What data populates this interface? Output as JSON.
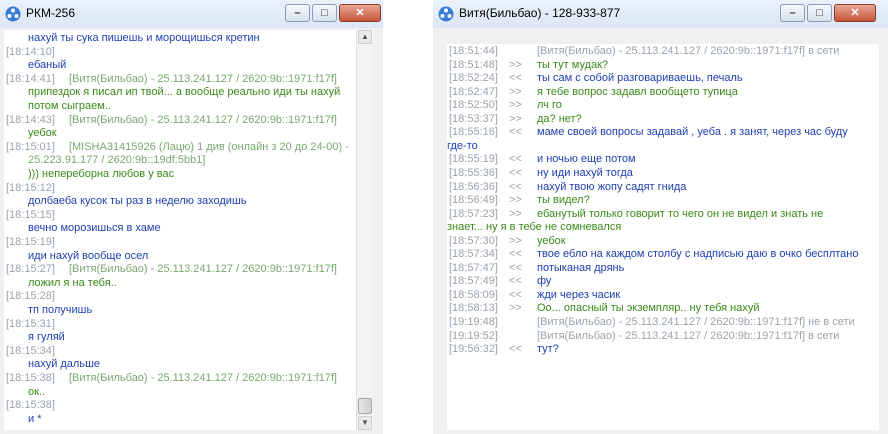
{
  "left_window": {
    "title": "РКМ-256",
    "buttons": {
      "minimize": "–",
      "maximize": "□",
      "close": "✕"
    },
    "messages": [
      {
        "ts": "",
        "text": "нахуй ты сука пишешь и морощишься кретин",
        "style": "me"
      },
      {
        "ts": "[18:14:10]",
        "text": "",
        "style": "ts"
      },
      {
        "ts": "",
        "text": "ебаный",
        "style": "me"
      },
      {
        "ts": "[18:14:41]",
        "text": "[Витя(Бильбао) - 25.113.241.127 / 2620:9b::1971:f17f]",
        "style": "info"
      },
      {
        "ts": "",
        "text": "припездок я писал ип твой... а вообще реально иди ты нахуй",
        "style": "peer"
      },
      {
        "ts": "",
        "text": "потом сыграем..",
        "style": "peer"
      },
      {
        "ts": "[18:14:43]",
        "text": "[Витя(Бильбао) - 25.113.241.127 / 2620:9b::1971:f17f]",
        "style": "info"
      },
      {
        "ts": "",
        "text": "уебок",
        "style": "peer"
      },
      {
        "ts": "[18:15:01]",
        "text": "[MISHA31415926 (Лацю) 1 див (онлайн з 20 до 24-00) -",
        "style": "info"
      },
      {
        "ts": "",
        "text": "25.223.91.177 / 2620:9b::19df:5bb1]",
        "style": "info"
      },
      {
        "ts": "",
        "text": "))) непереборна любов у вас",
        "style": "peer"
      },
      {
        "ts": "[18:15:12]",
        "text": "",
        "style": "ts"
      },
      {
        "ts": "",
        "text": "долбаеба кусок ты раз в неделю заходишь",
        "style": "me"
      },
      {
        "ts": "[18:15:15]",
        "text": "",
        "style": "ts"
      },
      {
        "ts": "",
        "text": "вечно морозишься в хаме",
        "style": "me"
      },
      {
        "ts": "[18:15:19]",
        "text": "",
        "style": "ts"
      },
      {
        "ts": "",
        "text": "иди нахуй вообще осел",
        "style": "me"
      },
      {
        "ts": "[18:15:27]",
        "text": "[Витя(Бильбао) - 25.113.241.127 / 2620:9b::1971:f17f]",
        "style": "info"
      },
      {
        "ts": "",
        "text": "ложил я на тебя..",
        "style": "peer"
      },
      {
        "ts": "[18:15:28]",
        "text": "",
        "style": "ts"
      },
      {
        "ts": "",
        "text": "тп получишь",
        "style": "me"
      },
      {
        "ts": "[18:15:31]",
        "text": "",
        "style": "ts"
      },
      {
        "ts": "",
        "text": "я гуляй",
        "style": "me"
      },
      {
        "ts": "[18:15:34]",
        "text": "",
        "style": "ts"
      },
      {
        "ts": "",
        "text": "нахуй дальше",
        "style": "me"
      },
      {
        "ts": "[18:15:38]",
        "text": "[Витя(Бильбао) - 25.113.241.127 / 2620:9b::1971:f17f]",
        "style": "info"
      },
      {
        "ts": "",
        "text": "ок..",
        "style": "peer"
      },
      {
        "ts": "[18:15:38]",
        "text": "",
        "style": "ts"
      },
      {
        "ts": "",
        "text": "и *",
        "style": "me"
      }
    ]
  },
  "right_window": {
    "title": "Витя(Бильбао) - 128-933-877",
    "buttons": {
      "minimize": "–",
      "maximize": "□",
      "close": "✕"
    },
    "messages": [
      {
        "ts": "[18:51:44]",
        "dir": "",
        "text": "[Витя(Бильбао) - 25.113.241.127 / 2620:9b::1971:f17f] в сети",
        "style": "sys"
      },
      {
        "ts": "[18:51:48]",
        "dir": ">>",
        "text": "ты тут мудак?",
        "style": "peer"
      },
      {
        "ts": "[18:52:24]",
        "dir": "<<",
        "text": "ты сам с собой разговариваешь, печаль",
        "style": "me"
      },
      {
        "ts": "[18:52:47]",
        "dir": ">>",
        "text": "я тебе вопрос задавл вообщето тупица",
        "style": "peer"
      },
      {
        "ts": "[18:52:50]",
        "dir": ">>",
        "text": "лч го",
        "style": "peer"
      },
      {
        "ts": "[18:53:37]",
        "dir": ">>",
        "text": "да? нет?",
        "style": "peer"
      },
      {
        "ts": "[18:55:16]",
        "dir": "<<",
        "text": "маме своей вопросы задавай , уеба . я занят, через час буду",
        "style": "me"
      },
      {
        "ts": "",
        "dir": "",
        "text": "где-то",
        "style": "me",
        "wrap": true
      },
      {
        "ts": "[18:55:19]",
        "dir": "<<",
        "text": "и ночью еще потом",
        "style": "me"
      },
      {
        "ts": "[18:55:36]",
        "dir": "<<",
        "text": "ну иди нахуй тогда",
        "style": "me"
      },
      {
        "ts": "[18:56:36]",
        "dir": "<<",
        "text": "нахуй твою жопу садят гнида",
        "style": "me"
      },
      {
        "ts": "[18:56:49]",
        "dir": ">>",
        "text": "ты видел?",
        "style": "peer"
      },
      {
        "ts": "[18:57:23]",
        "dir": ">>",
        "text": "ебанутый только говорит то чего он не видел и знать не",
        "style": "peer"
      },
      {
        "ts": "",
        "dir": "",
        "text": "знает... ну я в тебе не сомневался",
        "style": "peer",
        "wrap": true
      },
      {
        "ts": "[18:57:30]",
        "dir": ">>",
        "text": "уебок",
        "style": "peer"
      },
      {
        "ts": "[18:57:34]",
        "dir": "<<",
        "text": "твое ебло на каждом столбу с надписью даю в очко бесплтано",
        "style": "me"
      },
      {
        "ts": "[18:57:47]",
        "dir": "<<",
        "text": "потыканая дрянь",
        "style": "me"
      },
      {
        "ts": "[18:57:49]",
        "dir": "<<",
        "text": "фу",
        "style": "me"
      },
      {
        "ts": "[18:58:09]",
        "dir": "<<",
        "text": "жди через часик",
        "style": "me"
      },
      {
        "ts": "[18:58:13]",
        "dir": ">>",
        "text": "Оо... опасный ты экземпляр.. ну тебя нахуй",
        "style": "peer"
      },
      {
        "ts": "[19:19:48]",
        "dir": "",
        "text": "[Витя(Бильбао) - 25.113.241.127 / 2620:9b::1971:f17f] не в сети",
        "style": "sys"
      },
      {
        "ts": "[19:19:52]",
        "dir": "",
        "text": "[Витя(Бильбао) - 25.113.241.127 / 2620:9b::1971:f17f] в сети",
        "style": "sys"
      },
      {
        "ts": "[19:56:32]",
        "dir": "<<",
        "text": "тут?",
        "style": "me"
      }
    ]
  }
}
